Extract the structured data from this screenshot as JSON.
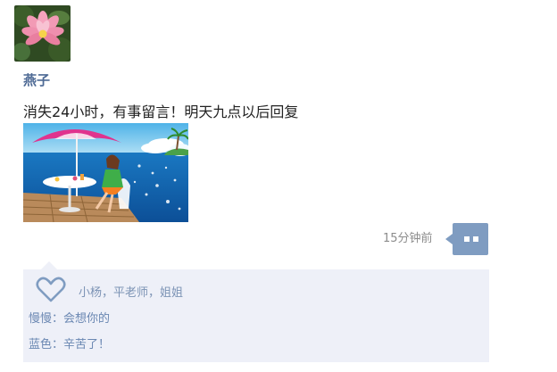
{
  "post": {
    "username": "燕子",
    "text": "消失24小时，有事留言！明天九点以后回复",
    "timestamp": "15分钟前"
  },
  "icons": {
    "comment": "comment-bubble-icon",
    "like": "heart-icon"
  },
  "interactions": {
    "likers": "小杨，平老师，姐姐",
    "comments": [
      {
        "author": "慢慢",
        "separator": "：",
        "text": "会想你的"
      },
      {
        "author": "蓝色",
        "separator": "：",
        "text": "辛苦了！"
      }
    ]
  },
  "colors": {
    "username": "#4e6a95",
    "accent": "#7f9cc1",
    "panel_bg": "#eef0f8",
    "link_text": "#6a87b2"
  }
}
